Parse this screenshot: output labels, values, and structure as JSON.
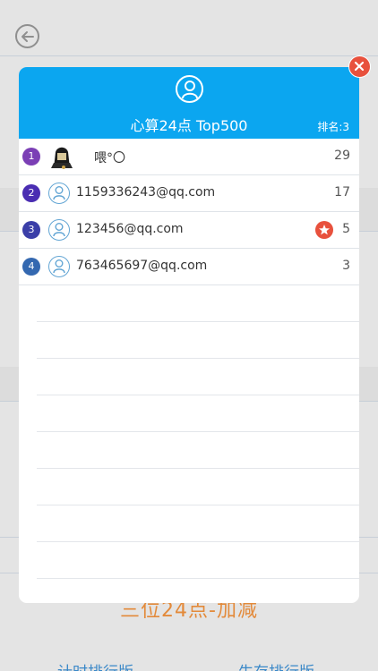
{
  "background": {
    "footer_title": "三位24点-加减",
    "footer_links": [
      "计时排行版",
      "生存排行版"
    ]
  },
  "modal": {
    "title": "心算24点 Top500",
    "rank_label": "排名:3",
    "colors": {
      "header": "#0ba6f0",
      "close": "#e8513d",
      "rank_badge": "#4a2db2"
    },
    "rows": [
      {
        "rank": "1",
        "name": "喂°〇",
        "score": "29",
        "avatar": "photo",
        "badge": false
      },
      {
        "rank": "2",
        "name": "1159336243@qq.com",
        "score": "17",
        "avatar": "user-icon",
        "badge": false
      },
      {
        "rank": "3",
        "name": "123456@qq.com",
        "score": "5",
        "avatar": "user-icon",
        "badge": true
      },
      {
        "rank": "4",
        "name": "763465697@qq.com",
        "score": "3",
        "avatar": "user-icon",
        "badge": false
      }
    ]
  }
}
